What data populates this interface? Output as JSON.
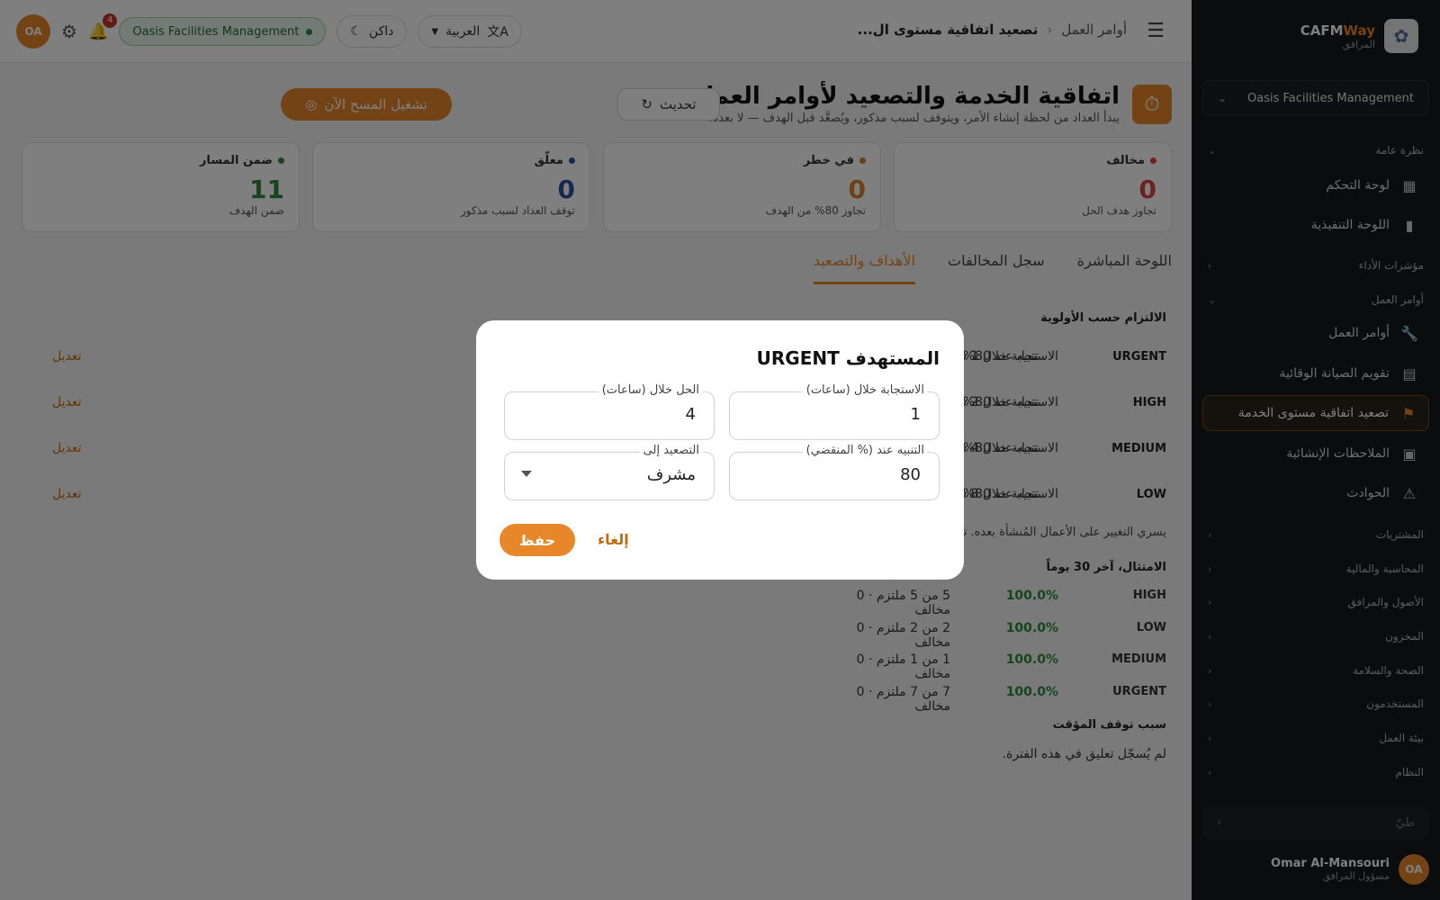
{
  "sidebar": {
    "brand_name_a": "CAFM",
    "brand_name_b": "Way",
    "brand_sub": "المرافق",
    "org": "Oasis Facilities Management",
    "groups": {
      "overview": "نظرة عامة",
      "kpis": "مؤشرات الأداء",
      "work_orders": "أوامر العمل",
      "procurement": "المشتريات",
      "accounting": "المحاسبة والمالية",
      "assets": "الأصول والمرافق",
      "inventory": "المخزون",
      "hse": "الصحة والسلامة",
      "users": "المستخدمون",
      "workspace": "بيئة العمل",
      "system": "النظام"
    },
    "items": {
      "dashboard": "لوحة التحكم",
      "executive": "اللوحة التنفيذية",
      "work_orders": "أوامر العمل",
      "pm_calendar": "تقويم الصيانة الوقائية",
      "sla": "تصعيد اتفاقية مستوى الخدمة",
      "snags": "الملاحظات الإنشائية",
      "incidents": "الحوادث"
    },
    "collapse_label": "طيّ",
    "user_initials": "OA",
    "user_name": "Omar Al-Mansouri",
    "user_role": "مسؤول المرافق"
  },
  "topbar": {
    "crumb_root": "أوامر العمل",
    "crumb_current": "تصعيد اتفاقية مستوى ال...",
    "language": "العربية",
    "theme": "داكن",
    "org_badge": "Oasis Facilities Management",
    "notif_count": "4",
    "user_initials": "OA"
  },
  "page": {
    "title": "اتفاقية الخدمة والتصعيد لأوامر العمل",
    "subtitle": "يبدأ العداد من لحظة إنشاء الأمر، ويتوقف لسبب مذكور، ويُصعَّد قبل الهدف — لا بعده.",
    "refresh": "تحديث",
    "run_scan": "تشغيل المسح الآن"
  },
  "kpis": [
    {
      "label": "مخالف",
      "value": "0",
      "desc": "تجاوز هدف الحل",
      "color": "#d64541"
    },
    {
      "label": "في خطر",
      "value": "0",
      "desc": "تجاوز 80% من الهدف",
      "color": "#d9822b"
    },
    {
      "label": "معلّق",
      "value": "0",
      "desc": "توقف العداد لسبب مذكور",
      "color": "#2f52a3"
    },
    {
      "label": "ضمن المسار",
      "value": "11",
      "desc": "ضمن الهدف",
      "color": "#2e8b3a"
    }
  ],
  "tabs": [
    "اللوحة المباشرة",
    "سجل المخالفات",
    "الأهداف والتصعيد"
  ],
  "targets": {
    "title": "الالتزام حسب الأولوية",
    "rows": [
      {
        "priority": "URGENT",
        "response": "الاستجابة خلال 1 س",
        "alert": "تنبيه عند 80% ← supervisor",
        "edit": "تعديل"
      },
      {
        "priority": "HIGH",
        "response": "الاستجابة خلال 2 س",
        "alert": "تنبيه عند 80% ← supervisor",
        "edit": "تعديل"
      },
      {
        "priority": "MEDIUM",
        "response": "الاستجابة خلال 4 س",
        "alert": "تنبيه عند 80% ← supervisor",
        "edit": "تعديل"
      },
      {
        "priority": "LOW",
        "response": "الاستجابة خلال 8 س",
        "alert": "تنبيه عند 80% ← supervisor",
        "edit": "تعديل"
      }
    ],
    "note": "يسري التغيير على الأعمال المُنشأة بعده. تحت"
  },
  "compliance": {
    "title": "الامتثال، آخر 30 يوماً",
    "rows": [
      {
        "priority": "HIGH",
        "pct": "100.0%",
        "detail": "5 من 5 ملتزم · 0 مخالف"
      },
      {
        "priority": "LOW",
        "pct": "100.0%",
        "detail": "2 من 2 ملتزم · 0 مخالف"
      },
      {
        "priority": "MEDIUM",
        "pct": "100.0%",
        "detail": "1 من 1 ملتزم · 0 مخالف"
      },
      {
        "priority": "URGENT",
        "pct": "100.0%",
        "detail": "7 من 7 ملتزم · 0 مخالف"
      }
    ]
  },
  "pause": {
    "title": "سبب توقف المؤقت",
    "empty": "لم يُسجّل تعليق في هذه الفترة."
  },
  "dialog": {
    "title": "المستهدف URGENT",
    "response_label": "الاستجابة خلال (ساعات)",
    "response_value": "1",
    "resolve_label": "الحل خلال (ساعات)",
    "resolve_value": "4",
    "alert_label": "التنبيه عند (% المنقضي)",
    "alert_value": "80",
    "escalate_label": "التصعيد إلى",
    "escalate_value": "مشرف",
    "cancel": "إلغاء",
    "save": "حفظ"
  },
  "colors": {
    "accent": "#e8862a",
    "success": "#2e8b3a",
    "sidebar_bg": "#16181d"
  }
}
